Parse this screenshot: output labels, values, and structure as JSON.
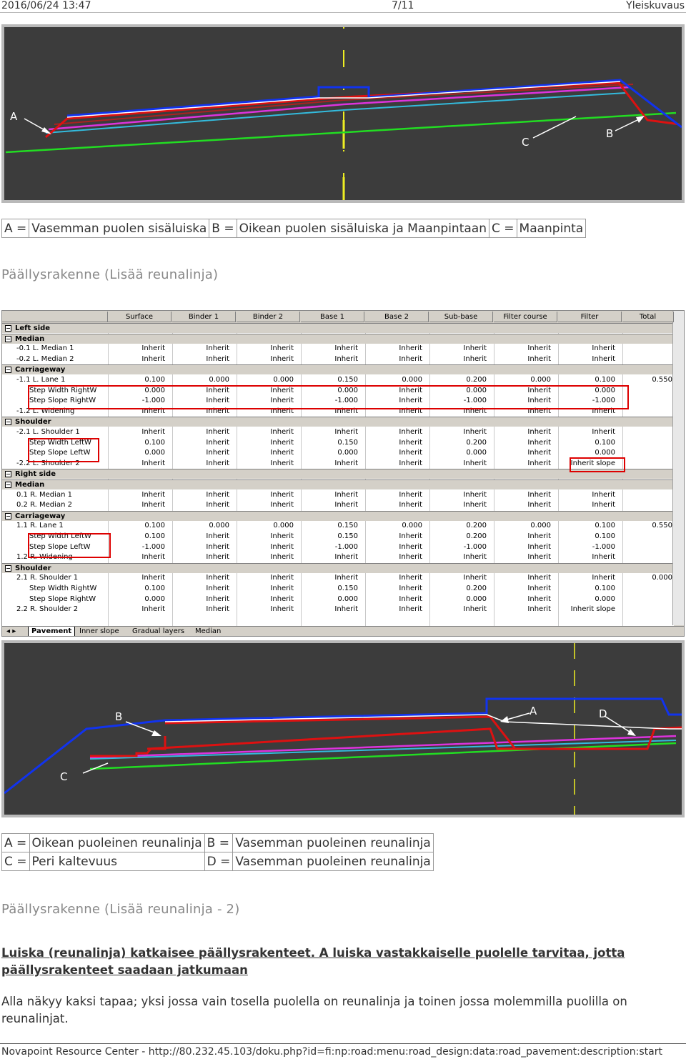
{
  "header": {
    "date": "2016/06/24 13:47",
    "page": "7/11",
    "title": "Yleiskuvaus"
  },
  "figure1": {
    "labels": {
      "a": "A",
      "b": "B",
      "c": "C"
    }
  },
  "legend1": [
    {
      "key": "A =",
      "value": "Vasemman puolen sisäluiska"
    },
    {
      "key": "B =",
      "value": "Oikean puolen sisäluiska ja Maanpintaan"
    },
    {
      "key": "C =",
      "value": "Maanpinta"
    }
  ],
  "heading1": "Päällysrakenne (Lisää reunalinja)",
  "grid": {
    "columns": [
      "Surface",
      "Binder 1",
      "Binder 2",
      "Base 1",
      "Base 2",
      "Sub-base",
      "Filter course",
      "Filter",
      "Total"
    ],
    "rows": [
      {
        "type": "group",
        "label": "Left side"
      },
      {
        "type": "group",
        "label": "Median"
      },
      {
        "type": "data",
        "label": "-0.1 L. Median 1",
        "values": [
          "Inherit",
          "Inherit",
          "Inherit",
          "Inherit",
          "Inherit",
          "Inherit",
          "Inherit",
          "Inherit",
          ""
        ]
      },
      {
        "type": "data",
        "label": "-0.2 L. Median 2",
        "values": [
          "Inherit",
          "Inherit",
          "Inherit",
          "Inherit",
          "Inherit",
          "Inherit",
          "Inherit",
          "Inherit",
          ""
        ]
      },
      {
        "type": "group",
        "label": "Carriageway"
      },
      {
        "type": "data",
        "label": "-1.1 L. Lane 1",
        "values": [
          "0.100",
          "0.000",
          "0.000",
          "0.150",
          "0.000",
          "0.200",
          "0.000",
          "0.100",
          "0.550"
        ]
      },
      {
        "type": "sub",
        "label": "Step Width RightW",
        "values": [
          "0.000",
          "Inherit",
          "Inherit",
          "0.000",
          "Inherit",
          "0.000",
          "Inherit",
          "0.000",
          ""
        ]
      },
      {
        "type": "sub",
        "label": "Step Slope RightW",
        "values": [
          "-1.000",
          "Inherit",
          "Inherit",
          "-1.000",
          "Inherit",
          "-1.000",
          "Inherit",
          "-1.000",
          ""
        ]
      },
      {
        "type": "data",
        "label": "-1.2 L. Widening",
        "values": [
          "Inherit",
          "Inherit",
          "Inherit",
          "Inherit",
          "Inherit",
          "Inherit",
          "Inherit",
          "Inherit",
          ""
        ]
      },
      {
        "type": "group",
        "label": "Shoulder"
      },
      {
        "type": "data",
        "label": "-2.1 L. Shoulder 1",
        "values": [
          "Inherit",
          "Inherit",
          "Inherit",
          "Inherit",
          "Inherit",
          "Inherit",
          "Inherit",
          "Inherit",
          ""
        ]
      },
      {
        "type": "sub",
        "label": "Step Width LeftW",
        "values": [
          "0.100",
          "Inherit",
          "Inherit",
          "0.150",
          "Inherit",
          "0.200",
          "Inherit",
          "0.100",
          ""
        ]
      },
      {
        "type": "sub",
        "label": "Step Slope LeftW",
        "values": [
          "0.000",
          "Inherit",
          "Inherit",
          "0.000",
          "Inherit",
          "0.000",
          "Inherit",
          "0.000",
          ""
        ]
      },
      {
        "type": "data",
        "label": "-2.2 L. Shoulder 2",
        "values": [
          "Inherit",
          "Inherit",
          "Inherit",
          "Inherit",
          "Inherit",
          "Inherit",
          "Inherit",
          "Inherit slope",
          ""
        ]
      },
      {
        "type": "group",
        "label": "Right side"
      },
      {
        "type": "group",
        "label": "Median"
      },
      {
        "type": "data",
        "label": "0.1 R. Median 1",
        "values": [
          "Inherit",
          "Inherit",
          "Inherit",
          "Inherit",
          "Inherit",
          "Inherit",
          "Inherit",
          "Inherit",
          ""
        ]
      },
      {
        "type": "data",
        "label": "0.2 R. Median 2",
        "values": [
          "Inherit",
          "Inherit",
          "Inherit",
          "Inherit",
          "Inherit",
          "Inherit",
          "Inherit",
          "Inherit",
          ""
        ]
      },
      {
        "type": "group",
        "label": "Carriageway"
      },
      {
        "type": "data",
        "label": "1.1 R. Lane 1",
        "values": [
          "0.100",
          "0.000",
          "0.000",
          "0.150",
          "0.000",
          "0.200",
          "0.000",
          "0.100",
          "0.550"
        ]
      },
      {
        "type": "sub",
        "label": "Step Width LeftW",
        "values": [
          "0.100",
          "Inherit",
          "Inherit",
          "0.150",
          "Inherit",
          "0.200",
          "Inherit",
          "0.100",
          ""
        ]
      },
      {
        "type": "sub",
        "label": "Step Slope LeftW",
        "values": [
          "-1.000",
          "Inherit",
          "Inherit",
          "-1.000",
          "Inherit",
          "-1.000",
          "Inherit",
          "-1.000",
          ""
        ]
      },
      {
        "type": "data",
        "label": "1.2 R. Widening",
        "values": [
          "Inherit",
          "Inherit",
          "Inherit",
          "Inherit",
          "Inherit",
          "Inherit",
          "Inherit",
          "Inherit",
          ""
        ]
      },
      {
        "type": "group",
        "label": "Shoulder"
      },
      {
        "type": "data",
        "label": "2.1 R. Shoulder 1",
        "values": [
          "Inherit",
          "Inherit",
          "Inherit",
          "Inherit",
          "Inherit",
          "Inherit",
          "Inherit",
          "Inherit",
          "0.000"
        ]
      },
      {
        "type": "sub",
        "label": "Step Width RightW",
        "values": [
          "0.100",
          "Inherit",
          "Inherit",
          "0.150",
          "Inherit",
          "0.200",
          "Inherit",
          "0.100",
          ""
        ]
      },
      {
        "type": "sub",
        "label": "Step Slope RightW",
        "values": [
          "0.000",
          "Inherit",
          "Inherit",
          "0.000",
          "Inherit",
          "0.000",
          "Inherit",
          "0.000",
          ""
        ]
      },
      {
        "type": "data",
        "label": "2.2 R. Shoulder 2",
        "values": [
          "Inherit",
          "Inherit",
          "Inherit",
          "Inherit",
          "Inherit",
          "Inherit",
          "Inherit",
          "Inherit slope",
          ""
        ]
      }
    ],
    "tabs": [
      "Pavement",
      "Inner slope",
      "Gradual layers",
      "Median"
    ]
  },
  "figure2": {
    "labels": {
      "a": "A",
      "b": "B",
      "c": "C",
      "d": "D"
    }
  },
  "legend2": [
    [
      {
        "key": "A =",
        "value": "Oikean puoleinen reunalinja"
      },
      {
        "key": "B =",
        "value": "Vasemman puoleinen reunalinja"
      }
    ],
    [
      {
        "key": "C =",
        "value": "Peri kaltevuus"
      },
      {
        "key": "D =",
        "value": "Vasemman puoleinen reunalinja"
      }
    ]
  ],
  "heading2": "Päällysrakenne (Lisää reunalinja - 2)",
  "section_title": "Luiska (reunalinja) katkaisee päällysrakenteet. A luiska vastakkaiselle puolelle tarvitaa, jotta päällysrakenteet saadaan jatkumaan",
  "paragraph": "Alla näkyy kaksi tapaa; yksi jossa vain tosella puolella on reunalinja ja toinen jossa molemmilla puolilla on reunalinjat.",
  "footer": "Novapoint Resource Center - http://80.232.45.103/doku.php?id=fi:np:road:menu:road_design:data:road_pavement:description:start",
  "colors": {
    "red": "#dd1111",
    "blue": "#1133ee",
    "magenta": "#dd33dd",
    "cyan": "#33bbdd",
    "green": "#22dd22",
    "yellow": "#eeee22",
    "cad_bg": "#3c3c3c"
  }
}
